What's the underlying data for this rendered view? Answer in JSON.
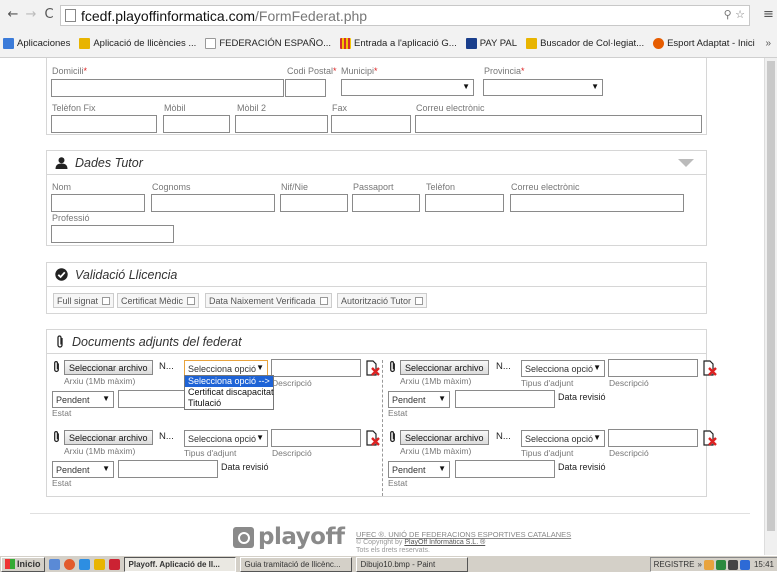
{
  "browser": {
    "url_host": "fcedf.playoffinformatica.com",
    "url_path": "/FormFederat.php",
    "bookmarks": [
      {
        "label": "Aplicaciones",
        "color": "#3b7bd9"
      },
      {
        "label": "Aplicació de llicències ...",
        "color": "#e8b400"
      },
      {
        "label": "FEDERACIÓN ESPAÑO...",
        "color": "#bbbbbb"
      },
      {
        "label": "Entrada a l'aplicació G...",
        "color": "#d32f2f"
      },
      {
        "label": "PAY PAL",
        "color": "#1a3e8c"
      },
      {
        "label": "Buscador de Col·legiat...",
        "color": "#e8b400"
      },
      {
        "label": "Esport Adaptat - Inici",
        "color": "#e65c00"
      }
    ],
    "bookmarks_more": "»"
  },
  "address": {
    "domicili_label": "Domicili",
    "codi_postal_label": "Codi Postal",
    "municipi_label": "Municipi",
    "provincia_label": "Provincia",
    "required_mark": "*",
    "telefon_fix_label": "Telèfon Fix",
    "mobil_label": "Mòbil",
    "mobil2_label": "Mòbil 2",
    "fax_label": "Fax",
    "correu_label": "Correu electrònic"
  },
  "tutor": {
    "title": "Dades Tutor",
    "nom_label": "Nom",
    "cognoms_label": "Cognoms",
    "nif_label": "Nif/Nie",
    "passaport_label": "Passaport",
    "telefon_label": "Telèfon",
    "correu_label": "Correu electrònic",
    "professio_label": "Professió"
  },
  "validacio": {
    "title": "Validació Llicencia",
    "badges": [
      "Full signat",
      "Certificat Mèdic",
      "Data Naixement Verificada",
      "Autorització Tutor"
    ]
  },
  "documents": {
    "title": "Documents adjunts del federat",
    "file_button": "Seleccionar archivo",
    "file_name": "N...",
    "file_hint": "Arxiu (1Mb màxim)",
    "tipus_select": "Selecciona opció",
    "tipus_label": "Tipus d'adjunt",
    "descripcio_label": "Descripció",
    "estat_value": "Pendent",
    "estat_label": "Estat",
    "data_revisio_label": "Data revisió",
    "dropdown_options": [
      "Selecciona opció -->",
      "Certificat discapacitat",
      "Titulació"
    ]
  },
  "footer": {
    "logo": "playoff",
    "line1": "UFEC ®. UNIÓ DE FEDERACIONS ESPORTIVES CATALANES",
    "line2_prefix": "© Copyright by ",
    "line2_link": "PlayOff Informàtica S.L. ®",
    "line3": "Tots els drets reservats."
  },
  "taskbar": {
    "start": "Inicio",
    "tasks": [
      {
        "label": "Playoff. Aplicació de ll...",
        "active": true
      },
      {
        "label": "Guia tramitació de llicènc...",
        "active": false
      },
      {
        "label": "Dibujo10.bmp - Paint",
        "active": false
      }
    ],
    "tray_label": "REGISTRE",
    "clock": "15:41"
  }
}
